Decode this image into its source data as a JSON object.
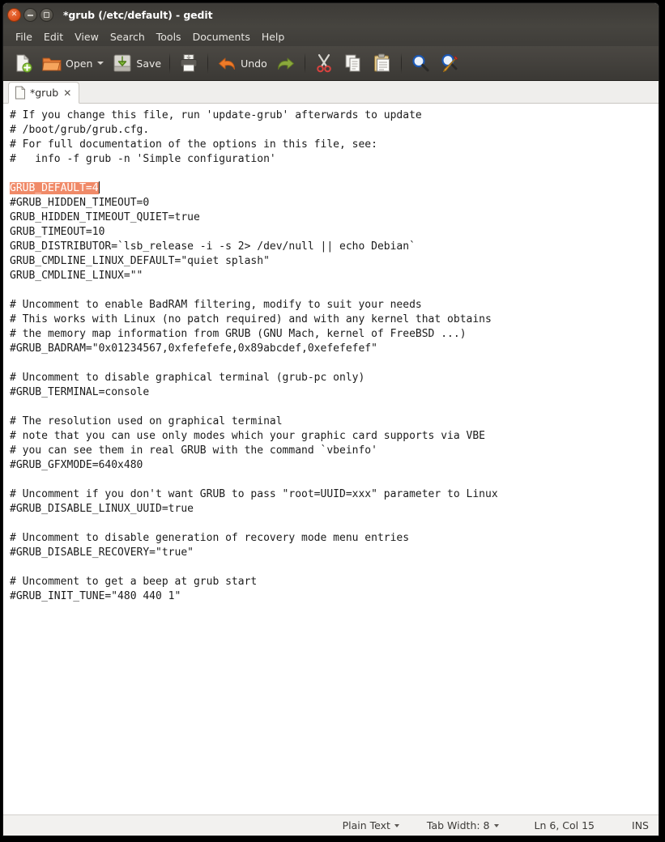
{
  "window": {
    "title": "*grub (/etc/default) - gedit",
    "buttons": {
      "close": "x",
      "minimize": "minimize",
      "maximize": "maximize"
    }
  },
  "menubar": {
    "items": [
      {
        "label": "File"
      },
      {
        "label": "Edit"
      },
      {
        "label": "View"
      },
      {
        "label": "Search"
      },
      {
        "label": "Tools"
      },
      {
        "label": "Documents"
      },
      {
        "label": "Help"
      }
    ]
  },
  "toolbar": {
    "new_label": "",
    "open_label": "Open",
    "save_label": "Save",
    "print_label": "",
    "undo_label": "Undo",
    "redo_label": "",
    "cut_label": "",
    "copy_label": "",
    "paste_label": "",
    "find_label": "",
    "replace_label": ""
  },
  "tabs": [
    {
      "label": "*grub",
      "close": "✕"
    }
  ],
  "editor": {
    "selection": "GRUB_DEFAULT=4",
    "selection_bg": "#f08a68",
    "selection_fg": "#ffffff",
    "lines_before": [
      "# If you change this file, run 'update-grub' afterwards to update",
      "# /boot/grub/grub.cfg.",
      "# For full documentation of the options in this file, see:",
      "#   info -f grub -n 'Simple configuration'",
      ""
    ],
    "lines_after": [
      "#GRUB_HIDDEN_TIMEOUT=0",
      "GRUB_HIDDEN_TIMEOUT_QUIET=true",
      "GRUB_TIMEOUT=10",
      "GRUB_DISTRIBUTOR=`lsb_release -i -s 2> /dev/null || echo Debian`",
      "GRUB_CMDLINE_LINUX_DEFAULT=\"quiet splash\"",
      "GRUB_CMDLINE_LINUX=\"\"",
      "",
      "# Uncomment to enable BadRAM filtering, modify to suit your needs",
      "# This works with Linux (no patch required) and with any kernel that obtains",
      "# the memory map information from GRUB (GNU Mach, kernel of FreeBSD ...)",
      "#GRUB_BADRAM=\"0x01234567,0xfefefefe,0x89abcdef,0xefefefef\"",
      "",
      "# Uncomment to disable graphical terminal (grub-pc only)",
      "#GRUB_TERMINAL=console",
      "",
      "# The resolution used on graphical terminal",
      "# note that you can use only modes which your graphic card supports via VBE",
      "# you can see them in real GRUB with the command `vbeinfo'",
      "#GRUB_GFXMODE=640x480",
      "",
      "# Uncomment if you don't want GRUB to pass \"root=UUID=xxx\" parameter to Linux",
      "#GRUB_DISABLE_LINUX_UUID=true",
      "",
      "# Uncomment to disable generation of recovery mode menu entries",
      "#GRUB_DISABLE_RECOVERY=\"true\"",
      "",
      "# Uncomment to get a beep at grub start",
      "#GRUB_INIT_TUNE=\"480 440 1\""
    ]
  },
  "statusbar": {
    "language": "Plain Text",
    "tab_width": "Tab Width: 8",
    "position": "Ln 6, Col 15",
    "insert_mode": "INS"
  }
}
